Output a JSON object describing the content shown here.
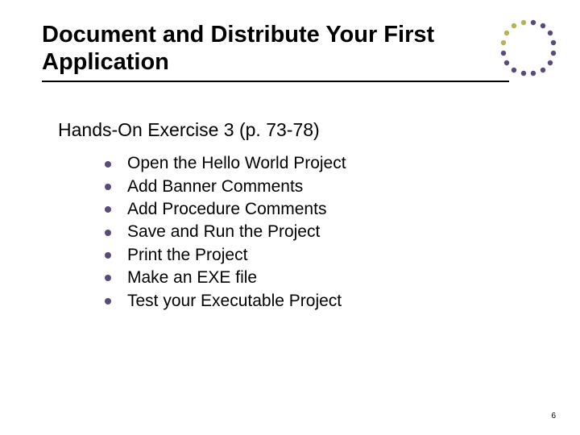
{
  "title": "Document and Distribute Your First Application",
  "subtitle": "Hands-On Exercise 3 (p. 73-78)",
  "items": [
    "Open the Hello World Project",
    "Add Banner Comments",
    "Add Procedure Comments",
    "Save and Run the Project",
    "Print the Project",
    "Make an EXE file",
    "Test your Executable Project"
  ],
  "pageNumber": "6",
  "colors": {
    "bullet": "#5a4a78",
    "decoDark": "#5a4a78",
    "decoLight": "#b9b05a"
  }
}
